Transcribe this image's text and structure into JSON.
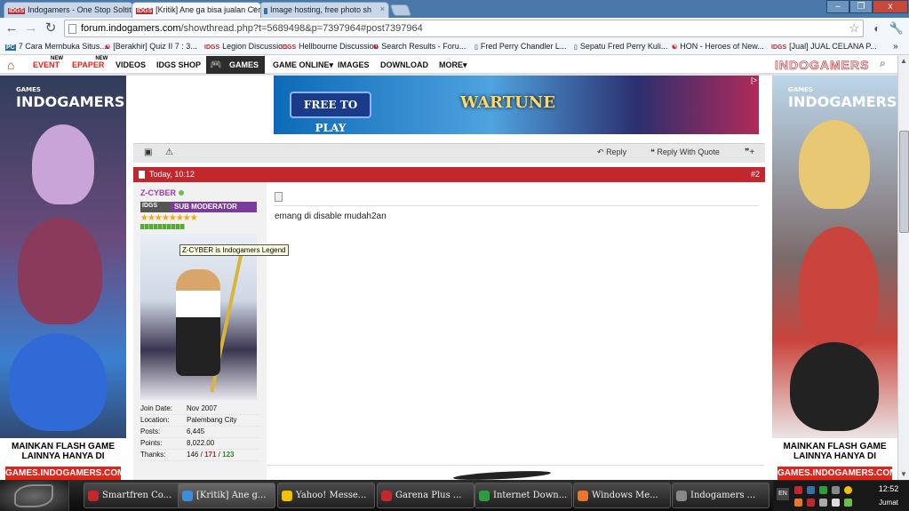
{
  "browser": {
    "tabs": [
      {
        "label": "Indogamers - One Stop Soluti",
        "icon": "IDGS",
        "active": false
      },
      {
        "label": "[Kritik] Ane ga bisa jualan Cer",
        "icon": "IDGS",
        "active": true
      },
      {
        "label": "Image hosting, free photo sh",
        "icon": "photobucket-icon",
        "active": false
      }
    ],
    "url_host": "forum.indogamers.com",
    "url_path": "/showthread.php?t=5689498&p=7397964#post7397964"
  },
  "bookmarks": [
    {
      "label": "7 Cara Membuka Situs...",
      "icon": "PC"
    },
    {
      "label": "[Berakhir] Quiz II 7 : 3...",
      "icon": "garena-icon"
    },
    {
      "label": "Legion Discussion",
      "icon": "IDGS"
    },
    {
      "label": "Hellbourne Discussion",
      "icon": "IDGS"
    },
    {
      "label": "Search Results - Foru...",
      "icon": "garena-icon"
    },
    {
      "label": "Fred Perry Chandler L...",
      "icon": "page-icon"
    },
    {
      "label": "Sepatu Fred Perry Kuli...",
      "icon": "page-icon"
    },
    {
      "label": "HON - Heroes of New...",
      "icon": "garena-icon"
    },
    {
      "label": "[Jual] JUAL CELANA P...",
      "icon": "IDGS"
    }
  ],
  "sitenav": {
    "event": "EVENT",
    "epaper": "EPAPER",
    "new_tag": "NEW",
    "videos": "VIDEOS",
    "shop": "IDGS SHOP",
    "games": "GAMES",
    "game_online": "GAME ONLINE",
    "images": "IMAGES",
    "download": "DOWNLOAD",
    "more": "MORE",
    "logo": "INDOGAMERS"
  },
  "side_ads": {
    "brand_small": "GAMES",
    "brand": "INDOGAMERS",
    "footer": "MAINKAN FLASH GAME LAINNYA HANYA DI",
    "url": "GAMES.INDOGAMERS.COM"
  },
  "banner": {
    "play_label": "FREE TO PLAY",
    "game_name": "WARTUNE",
    "ad_mark": "[>"
  },
  "post_toolbar": {
    "reply": "Reply",
    "reply_quote": "Reply With Quote"
  },
  "post": {
    "date": "Today, 10:12",
    "number": "#2",
    "username": "Z-CYBER",
    "rank_logo": "IDGS",
    "rank": "SUB MODERATOR",
    "stars": "★★★★★★★★",
    "tooltip": "Z-CYBER is Indogamers Legend",
    "info": [
      {
        "key": "Join Date:",
        "value": "Nov 2007"
      },
      {
        "key": "Location:",
        "value": "Palembang City"
      },
      {
        "key": "Posts:",
        "value": "6,445"
      },
      {
        "key": "Points:",
        "value": "8,022.00"
      }
    ],
    "thanks_key": "Thanks:",
    "thanks_a": "146",
    "thanks_b": "171",
    "thanks_c": "123",
    "thanks_sep": "/",
    "message": "emang di disable mudah2an"
  },
  "taskbar": {
    "items": [
      {
        "label": "Smartfren Co...",
        "color": "#c1272d"
      },
      {
        "label": "[Kritik] Ane g...",
        "color": "#3b8ed8",
        "active": true
      },
      {
        "label": "Yahoo! Messe...",
        "color": "#f2c200"
      },
      {
        "label": "Garena Plus ...",
        "color": "#c1272d"
      },
      {
        "label": "Internet Down...",
        "color": "#2e9c3e"
      },
      {
        "label": "Windows Me...",
        "color": "#e8762c"
      },
      {
        "label": "Indogamers ...",
        "color": "#888"
      }
    ],
    "lang": "EN",
    "time": "12:52",
    "day": "Jumat"
  }
}
